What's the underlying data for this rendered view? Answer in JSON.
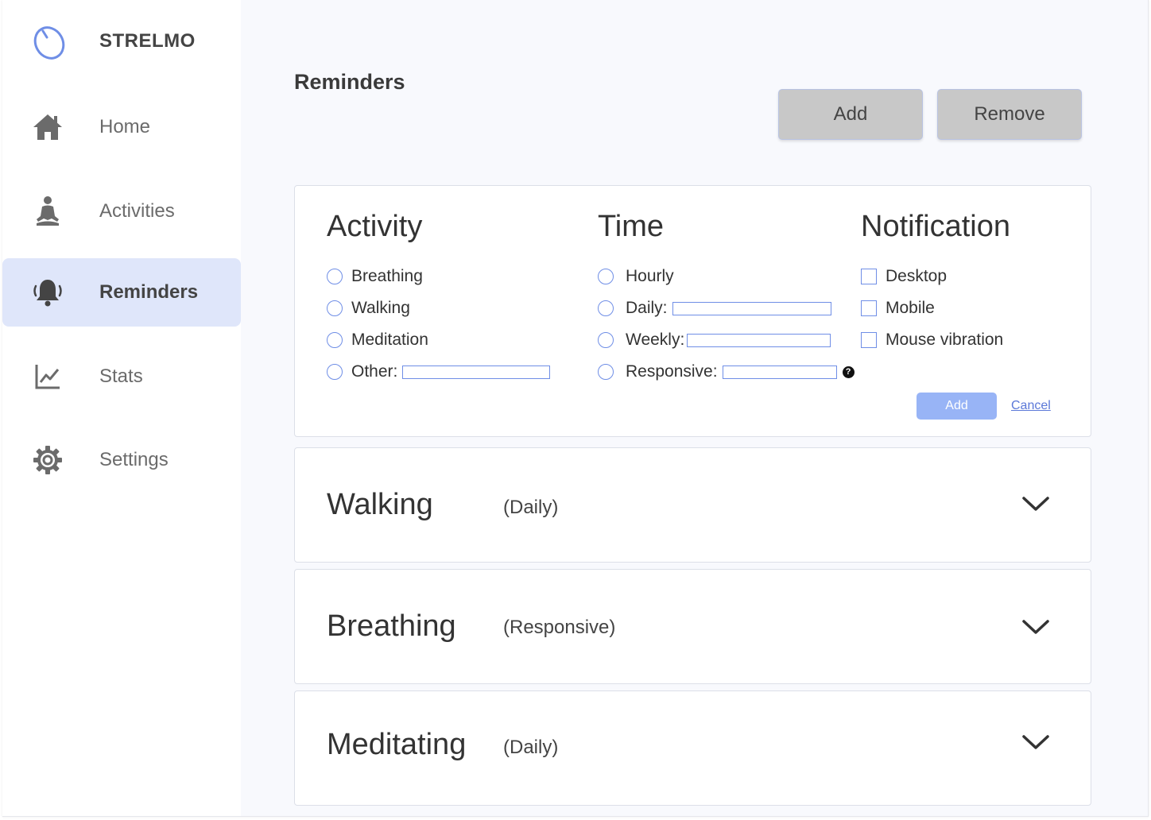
{
  "app": {
    "name": "STRELMO"
  },
  "sidebar": {
    "items": [
      {
        "label": "Home",
        "icon": "home-icon"
      },
      {
        "label": "Activities",
        "icon": "meditation-icon"
      },
      {
        "label": "Reminders",
        "icon": "bell-icon",
        "active": true
      },
      {
        "label": "Stats",
        "icon": "chart-icon"
      },
      {
        "label": "Settings",
        "icon": "gear-icon"
      }
    ]
  },
  "header": {
    "title": "Reminders",
    "add_label": "Add",
    "remove_label": "Remove"
  },
  "form": {
    "activity": {
      "title": "Activity",
      "options": [
        "Breathing",
        "Walking",
        "Meditation",
        "Other:"
      ]
    },
    "time": {
      "title": "Time",
      "options": [
        "Hourly",
        "Daily:",
        "Weekly:",
        "Responsive:"
      ]
    },
    "notification": {
      "title": "Notification",
      "options": [
        "Desktop",
        "Mobile",
        "Mouse vibration"
      ]
    },
    "help_icon": "question-icon",
    "add_label": "Add",
    "cancel_label": "Cancel"
  },
  "reminders": [
    {
      "name": "Walking",
      "frequency": "(Daily)"
    },
    {
      "name": "Breathing",
      "frequency": "(Responsive)"
    },
    {
      "name": "Meditating",
      "frequency": "(Daily)"
    }
  ],
  "colors": {
    "accent": "#6f8ee6",
    "active_nav": "#dfe6fa",
    "button_gray": "#c8c8c8",
    "small_button": "#98b4f6"
  }
}
